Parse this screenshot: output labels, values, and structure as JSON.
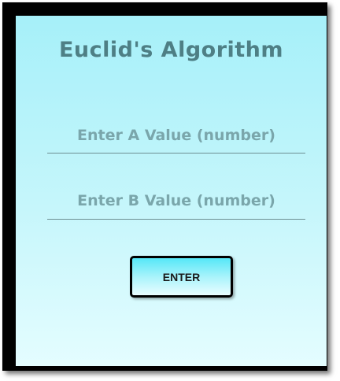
{
  "app": {
    "title": "Euclid's Algorithm"
  },
  "form": {
    "field_a": {
      "value": "",
      "placeholder": "Enter A Value (number)"
    },
    "field_b": {
      "value": "",
      "placeholder": "Enter B Value (number)"
    },
    "submit_label": "ENTER"
  },
  "colors": {
    "frame": "#000000",
    "panel_top": "#a6f0f9",
    "panel_bottom": "#e4fdff",
    "title_text": "#4e7f85",
    "placeholder_text": "#7aa6ab",
    "underline": "#6d8f93",
    "button_gradient_top": "#55e7f7"
  }
}
